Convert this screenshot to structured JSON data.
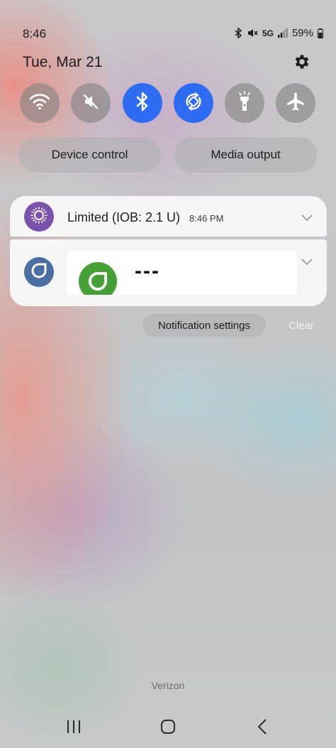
{
  "status_bar": {
    "time": "8:46",
    "network": "5G",
    "battery": "59%",
    "icons": [
      "bluetooth-icon",
      "mute-icon",
      "signal-icon",
      "battery-icon"
    ]
  },
  "header": {
    "date": "Tue, Mar 21",
    "settings_icon": "gear-icon"
  },
  "quick_toggles": [
    {
      "name": "wifi",
      "icon": "wifi-icon",
      "state": "off"
    },
    {
      "name": "sound",
      "icon": "mute-icon",
      "state": "off"
    },
    {
      "name": "bluetooth",
      "icon": "bluetooth-icon",
      "state": "on"
    },
    {
      "name": "auto-rotate",
      "icon": "rotate-icon",
      "state": "on"
    },
    {
      "name": "flashlight",
      "icon": "flashlight-icon",
      "state": "off"
    },
    {
      "name": "airplane-mode",
      "icon": "airplane-icon",
      "state": "off"
    }
  ],
  "panel_buttons": {
    "device_control": "Device control",
    "media_output": "Media output"
  },
  "notifications": [
    {
      "title": "Limited (IOB: 2.1 U)",
      "time": "8:46 PM",
      "icon": "sun-icon"
    },
    {
      "icon": "dexcom-icon",
      "widget_value": "---"
    }
  ],
  "footer": {
    "notification_settings": "Notification settings",
    "clear": "Clear",
    "carrier": "Verizon"
  },
  "colors": {
    "toggle_on": "#2f6cf4",
    "app_icon_1": "#7a51ab",
    "app_icon_2": "#4a6fa0",
    "widget_icon": "#45a135"
  }
}
